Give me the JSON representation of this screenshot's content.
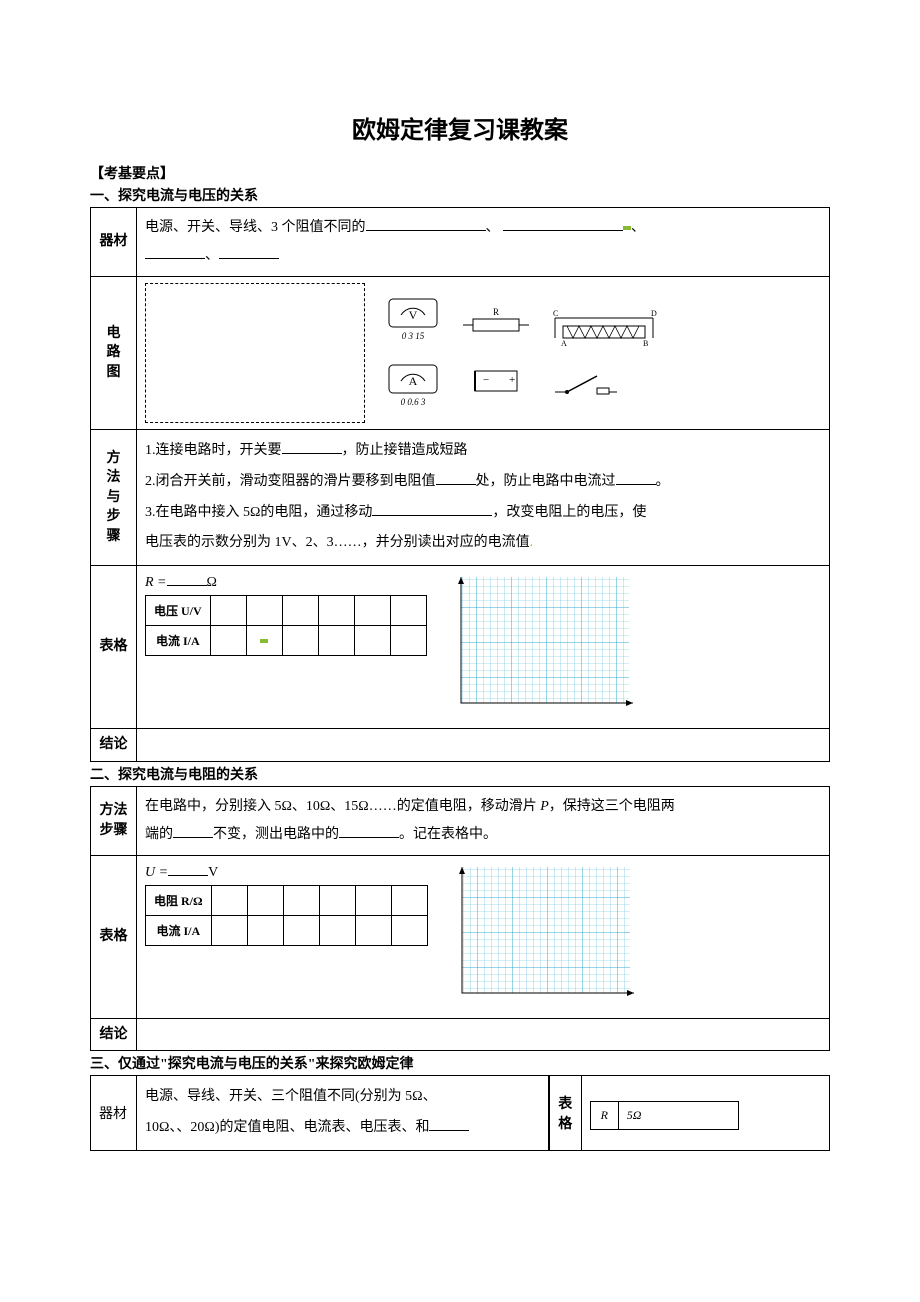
{
  "title": "欧姆定律复习课教案",
  "heads": {
    "exam": "【考基要点】",
    "s1": "一、探究电流与电压的关系",
    "s2": "二、探究电流与电阻的关系",
    "s3": "三、仅通过\"探究电流与电压的关系\"来探究欧姆定律"
  },
  "labels": {
    "equipment": "器材",
    "circuit": "电\n路\n图",
    "method": "方\n法\n与\n步\n骤",
    "table": "表格",
    "conclusion": "结论",
    "method2": "方法\n步骤",
    "table2": "表\n格"
  },
  "s1": {
    "equip": "电源、开关、导线、3 个阻值不同的",
    "m1": "1.连接电路时，开关要",
    "m1b": "，防止接错造成短路",
    "m2": "2.闭合开关前，滑动变阻器的滑片要移到电阻值",
    "m2b": "处，防止电路中电流过",
    "m2c": "。",
    "m3a": "3.在电路中接入 5",
    "m3b": "的电阻，通过移动",
    "m3c": "，改变电阻上的电压，使",
    "m3d": "电压表的示数分别为 1V、2、3……，并分别读出对应的电流值",
    "r_eq": "R =",
    "r_unit": "Ω",
    "row_u": "电压 U/V",
    "row_i": "电流 I/A"
  },
  "s2": {
    "m1a": "在电路中，分别接入 5Ω、10Ω、15Ω……的定值电阻，移动滑片 ",
    "m1p": "P",
    "m1b": "，保持这三个电阻两",
    "m1c": "端的",
    "m1d": "不变，测出电路中的",
    "m1e": "。记在表格中。",
    "u_eq": "U =",
    "u_unit": "V",
    "row_r": "电阻 R/Ω",
    "row_i": "电流 I/A"
  },
  "s3": {
    "equip_a": "电源、导线、开关、三个阻值不同(分别为 5",
    "equip_b": "、",
    "equip_c": "10",
    "equip_d": "、20",
    "equip_e": ")的定值电阻、电流表、电压表、和",
    "r_label": "R",
    "r_val": "5Ω"
  },
  "meters": {
    "v": "V",
    "a": "A",
    "v_scale": "0 3 15",
    "a_sub": "0 0.6 3"
  }
}
